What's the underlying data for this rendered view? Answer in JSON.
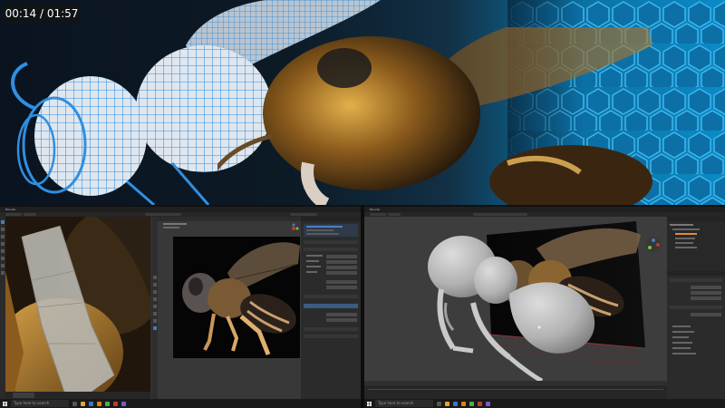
{
  "video_overlay": {
    "timestamp": "00:14 / 01:57"
  },
  "left_screen": {
    "title_bar": "Blender",
    "viewport_footer_button": "",
    "taskbar": {
      "search_placeholder": "Type here to search",
      "tray_time": "",
      "tray_date": ""
    }
  },
  "right_screen": {
    "title_bar": "Blender",
    "taskbar": {
      "search_placeholder": "Type here to search",
      "tray_time": "",
      "tray_date": ""
    }
  },
  "colors": {
    "honeycomb": "#1b8fc9",
    "wireframe": "#2f8fe0",
    "blender_bg": "#303030",
    "viewport_grey": "#3d3d3d",
    "bee_amber": "#c98a2e",
    "grid_red": "#c0392b"
  },
  "icons": {
    "start": "windows-start-icon",
    "search": "search-icon",
    "gizmo": "navigation-gizmo-icon"
  }
}
